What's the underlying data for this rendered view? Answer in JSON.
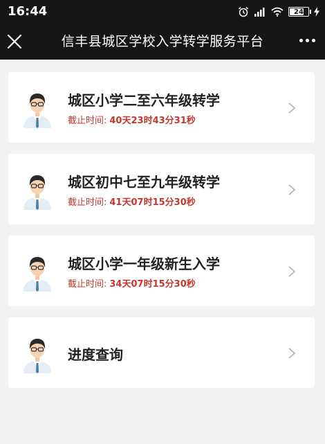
{
  "status_bar": {
    "time": "16:44",
    "battery": "24",
    "icons": [
      "alarm-icon",
      "signal-icon",
      "wifi-icon",
      "battery-icon",
      "charging-icon"
    ]
  },
  "nav": {
    "title": "信丰县城区学校入学转学服务平台",
    "close_icon": "close-icon",
    "more_icon": "more-icon"
  },
  "cards": [
    {
      "title": "城区小学二至六年级转学",
      "deadline_label": "截止时间:",
      "deadline_value": "40天23时43分31秒"
    },
    {
      "title": "城区初中七至九年级转学",
      "deadline_label": "截止时间:",
      "deadline_value": "41天07时15分30秒"
    },
    {
      "title": "城区小学一年级新生入学",
      "deadline_label": "截止时间:",
      "deadline_value": "34天07时15分30秒"
    },
    {
      "title": "进度查询"
    }
  ],
  "colors": {
    "bar_background": "#161616",
    "page_background": "#f2f2f2",
    "deadline_red": "#c0392b"
  }
}
